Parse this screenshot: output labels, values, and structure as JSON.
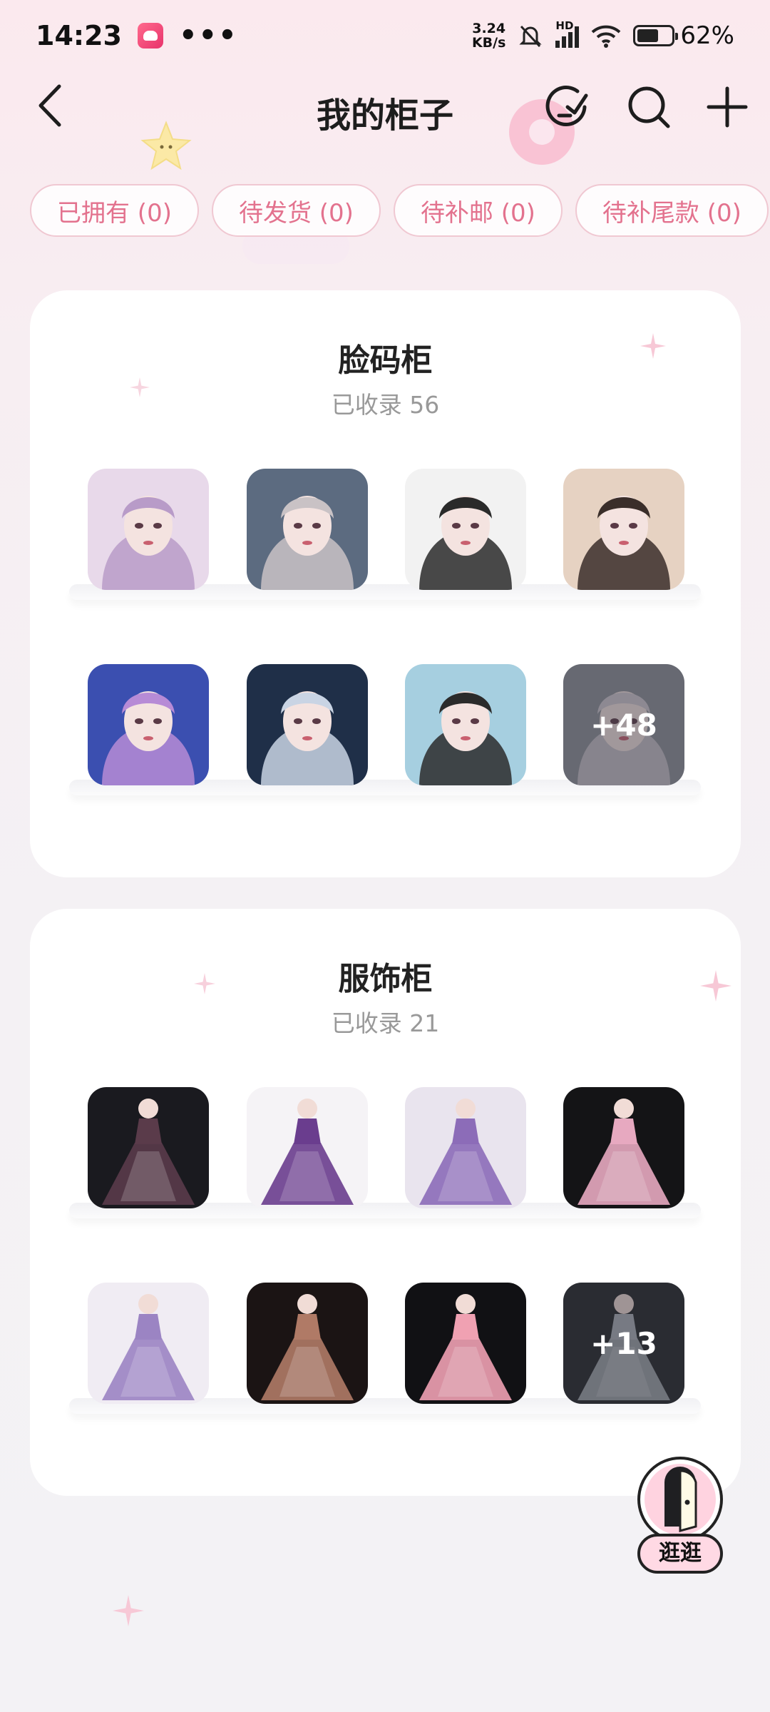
{
  "status_bar": {
    "time": "14:23",
    "dots": "•••",
    "net_speed_value": "3.24",
    "net_speed_unit": "KB/s",
    "network_label": "HD",
    "battery_percent": "62%",
    "battery_level": 0.62
  },
  "header": {
    "title": "我的柜子",
    "icons": [
      "back-icon",
      "manage-icon",
      "search-icon",
      "add-icon"
    ]
  },
  "tabs": [
    {
      "label": "已拥有 (0)"
    },
    {
      "label": "待发货 (0)"
    },
    {
      "label": "待补邮 (0)"
    },
    {
      "label": "待补尾款 (0)"
    }
  ],
  "cabinets": [
    {
      "title": "脸码柜",
      "count_label": "已收录 56",
      "thumbs": [
        {
          "kind": "face",
          "bg": [
            "#e8d9ea",
            "#b89bc8"
          ]
        },
        {
          "kind": "face",
          "bg": [
            "#5c6b80",
            "#c9c2c5"
          ]
        },
        {
          "kind": "face",
          "bg": [
            "#f2f2f2",
            "#2a2a2a"
          ]
        },
        {
          "kind": "face",
          "bg": [
            "#e6d2c2",
            "#3a2e2a"
          ]
        },
        {
          "kind": "face",
          "bg": [
            "#3b4fb0",
            "#b78bd6"
          ]
        },
        {
          "kind": "face",
          "bg": [
            "#1f2f48",
            "#c9d4e4"
          ]
        },
        {
          "kind": "face",
          "bg": [
            "#a6cfe0",
            "#2b2b2b"
          ]
        },
        {
          "kind": "face",
          "bg": [
            "#8a8f96",
            "#cfc8cf"
          ]
        }
      ],
      "more_label": "+48"
    },
    {
      "title": "服饰柜",
      "count_label": "已收录 21",
      "thumbs": [
        {
          "kind": "dress",
          "bg": [
            "#1a1a1f",
            "#5a3b4a"
          ]
        },
        {
          "kind": "dress",
          "bg": [
            "#f5f3f6",
            "#6a3d8e"
          ]
        },
        {
          "kind": "dress",
          "bg": [
            "#e9e4ee",
            "#8c6cb8"
          ]
        },
        {
          "kind": "dress",
          "bg": [
            "#141416",
            "#e7a9c0"
          ]
        },
        {
          "kind": "dress",
          "bg": [
            "#f0ecf3",
            "#9b84c3"
          ]
        },
        {
          "kind": "dress",
          "bg": [
            "#1b1414",
            "#b07a66"
          ]
        },
        {
          "kind": "dress",
          "bg": [
            "#111114",
            "#f0a1b2"
          ]
        },
        {
          "kind": "dress",
          "bg": [
            "#1c1f22",
            "#a8aeb4"
          ]
        }
      ],
      "more_label": "+13"
    }
  ],
  "float_button": {
    "label": "逛逛",
    "icon": "door-icon"
  },
  "colors": {
    "accent_pink": "#e3728e",
    "tab_border": "#f0c8d2",
    "title_text": "#222222",
    "sub_text": "#999999"
  }
}
